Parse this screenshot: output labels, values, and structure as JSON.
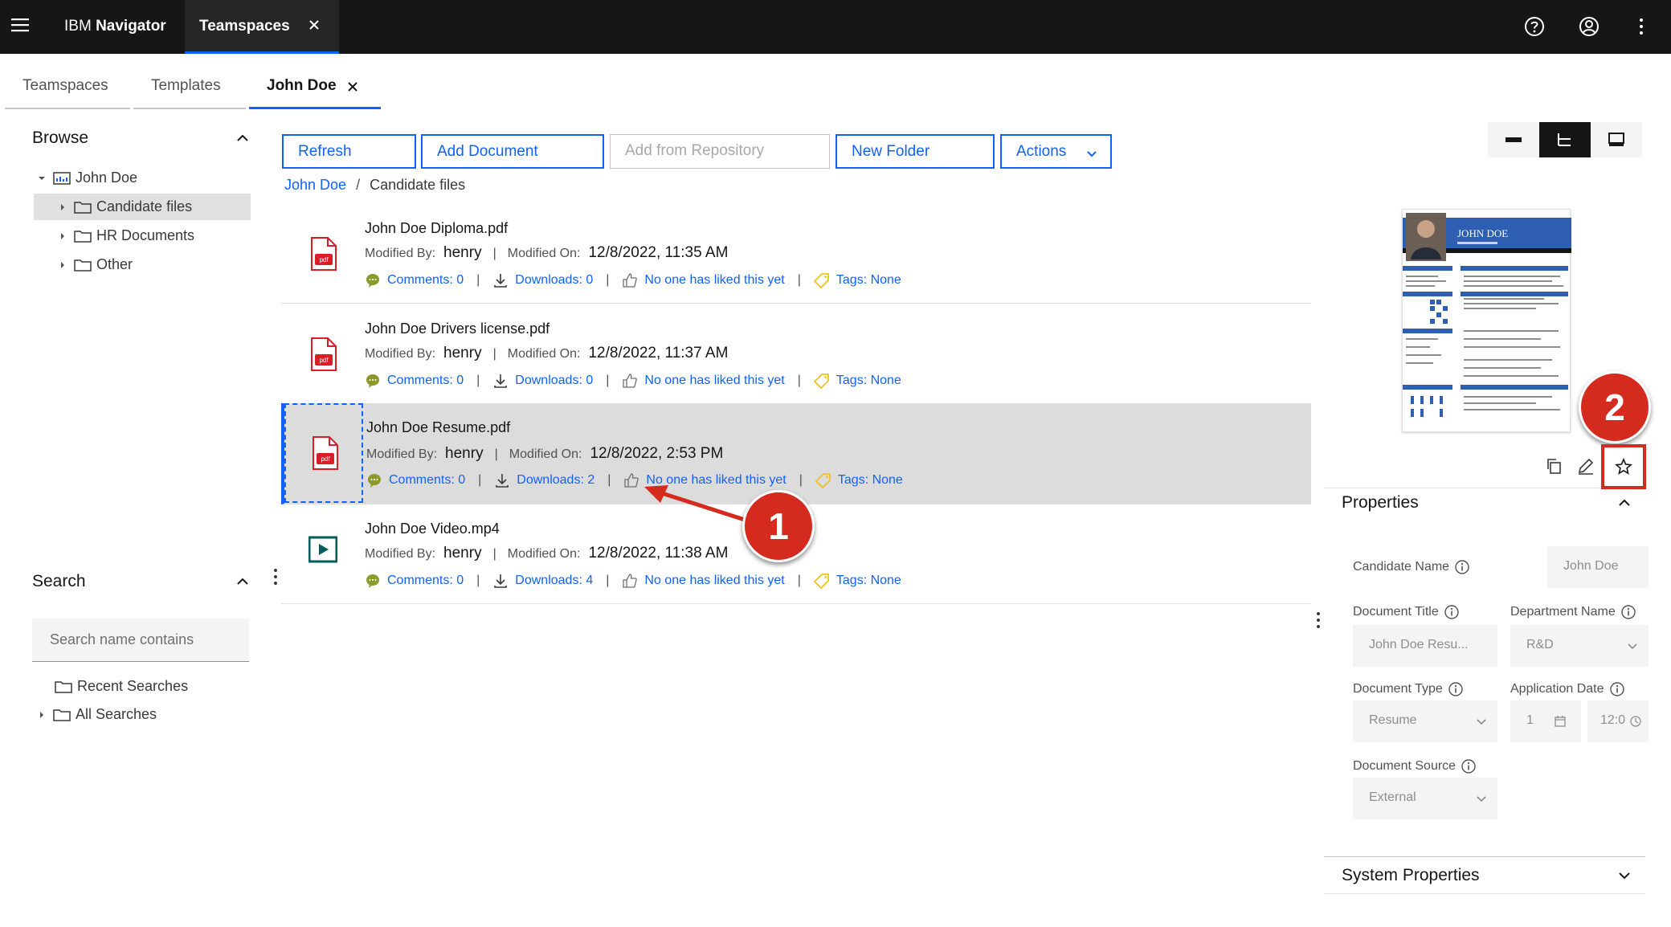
{
  "header": {
    "brand_light": "IBM",
    "brand_bold": "Navigator",
    "tab_label": "Teamspaces",
    "icons": [
      "menu-icon",
      "help-icon",
      "user-icon",
      "overflow-menu-icon",
      "close-icon"
    ]
  },
  "subtabs": [
    "Teamspaces",
    "Templates",
    "John Doe"
  ],
  "browse": {
    "title": "Browse",
    "root": "John Doe",
    "items": [
      "Candidate files",
      "HR Documents",
      "Other"
    ]
  },
  "search": {
    "title": "Search",
    "placeholder": "Search name contains",
    "items": [
      "Recent Searches",
      "All Searches"
    ]
  },
  "toolbar": {
    "refresh": "Refresh",
    "add_document": "Add Document",
    "add_from_repo": "Add from Repository",
    "new_folder": "New Folder",
    "actions": "Actions"
  },
  "breadcrumb": {
    "root": "John Doe",
    "separator": "/",
    "current": "Candidate files"
  },
  "labels": {
    "modified_by": "Modified By:",
    "modified_on": "Modified On:"
  },
  "documents": [
    {
      "name": "John Doe Diploma.pdf",
      "modified_by": "henry",
      "modified_on": "12/8/2022, 11:35 AM",
      "comments": "Comments: 0",
      "downloads": "Downloads: 0",
      "likes": "No one has liked this yet",
      "tags": "Tags: None",
      "type": "pdf"
    },
    {
      "name": "John Doe Drivers license.pdf",
      "modified_by": "henry",
      "modified_on": "12/8/2022, 11:37 AM",
      "comments": "Comments: 0",
      "downloads": "Downloads: 0",
      "likes": "No one has liked this yet",
      "tags": "Tags: None",
      "type": "pdf"
    },
    {
      "name": "John Doe Resume.pdf",
      "modified_by": "henry",
      "modified_on": "12/8/2022, 2:53 PM",
      "comments": "Comments: 0",
      "downloads": "Downloads: 2",
      "likes": "No one has liked this yet",
      "tags": "Tags: None",
      "type": "pdf"
    },
    {
      "name": "John Doe Video.mp4",
      "modified_by": "henry",
      "modified_on": "12/8/2022, 11:38 AM",
      "comments": "Comments: 0",
      "downloads": "Downloads: 4",
      "likes": "No one has liked this yet",
      "tags": "Tags: None",
      "type": "video"
    }
  ],
  "preview": {
    "name_text": "JOHN DOE"
  },
  "properties": {
    "title": "Properties",
    "candidate_name_label": "Candidate Name",
    "candidate_name_value": "John Doe",
    "document_title_label": "Document Title",
    "document_title_value": "John Doe Resu...",
    "department_name_label": "Department Name",
    "department_name_value": "R&D",
    "document_type_label": "Document Type",
    "document_type_value": "Resume",
    "application_date_label": "Application Date",
    "application_date_value": "1",
    "application_time_value": "12:0",
    "document_source_label": "Document Source",
    "document_source_value": "External",
    "system_properties": "System Properties"
  },
  "annotations": {
    "step1": "1",
    "step2": "2"
  },
  "colors": {
    "accent": "#0f62fe",
    "header_bg": "#161616",
    "annotation": "#d42b1e",
    "pdf_red": "#da1e28",
    "comment_green": "#8a9a2b",
    "tag_yellow": "#f1c21b"
  }
}
